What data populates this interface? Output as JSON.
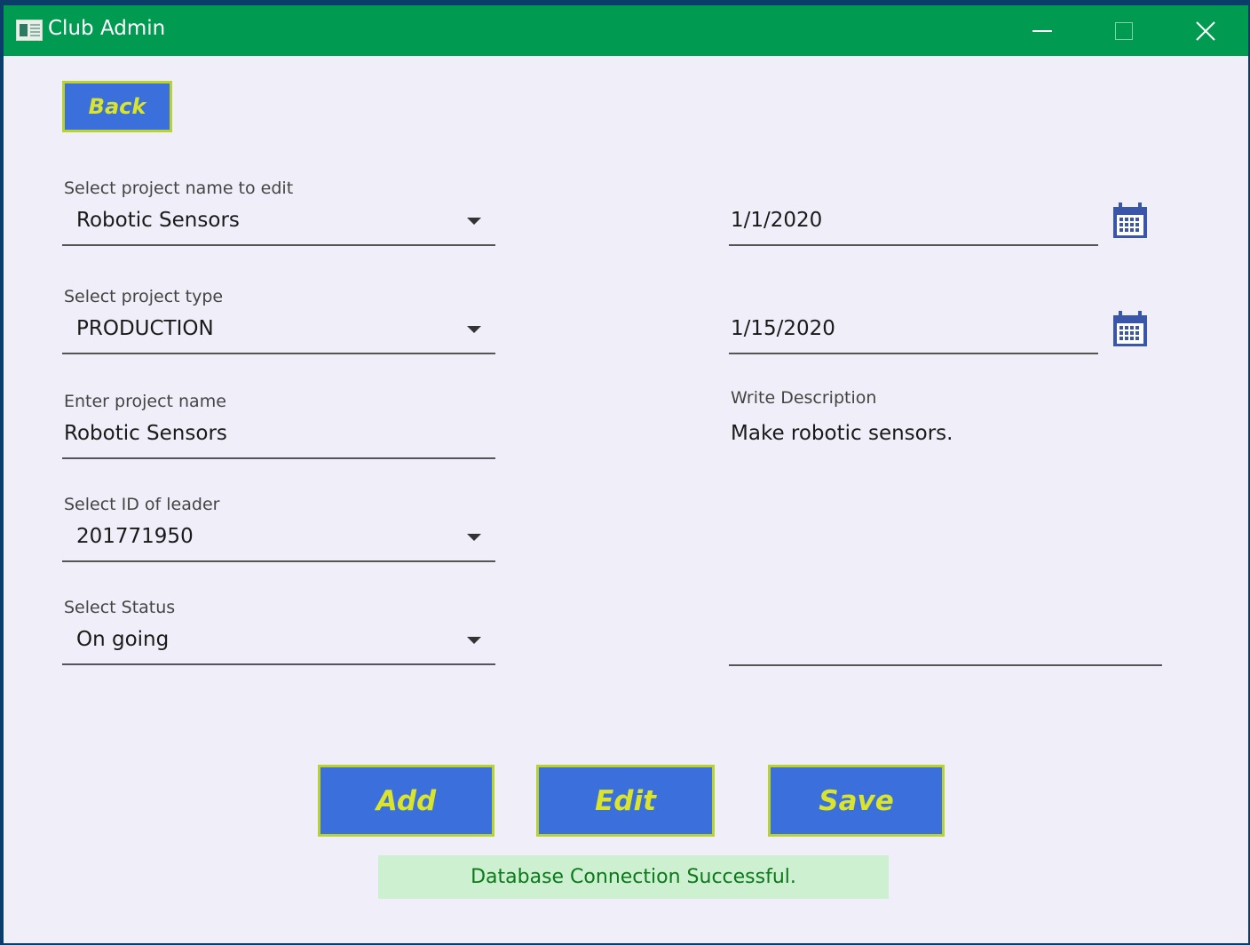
{
  "window": {
    "title": "Club Admin",
    "colors": {
      "titlebar": "#009a50",
      "button_fill": "#3a6fdc",
      "button_border": "#b9d22e",
      "button_text": "#d9e42a",
      "status_bg": "#ccf0d0",
      "status_text": "#0a7a1a"
    },
    "controls": {
      "minimize_icon": "minimize-icon",
      "maximize_icon": "maximize-icon",
      "close_icon": "close-icon"
    }
  },
  "buttons": {
    "back": "Back",
    "add": "Add",
    "edit": "Edit",
    "save": "Save"
  },
  "form": {
    "project_select": {
      "label": "Select project name to edit",
      "value": "Robotic Sensors"
    },
    "project_type": {
      "label": "Select project type",
      "value": "PRODUCTION"
    },
    "project_name": {
      "label": "Enter project name",
      "value": "Robotic Sensors"
    },
    "leader_id": {
      "label": "Select ID of leader",
      "value": "201771950"
    },
    "status": {
      "label": "Select Status",
      "value": "On going"
    },
    "start_date": {
      "value": "1/1/2020",
      "icon": "calendar-icon"
    },
    "end_date": {
      "value": "1/15/2020",
      "icon": "calendar-icon"
    },
    "description": {
      "label": "Write Description",
      "value": "Make robotic sensors."
    }
  },
  "status_message": "Database Connection Successful."
}
